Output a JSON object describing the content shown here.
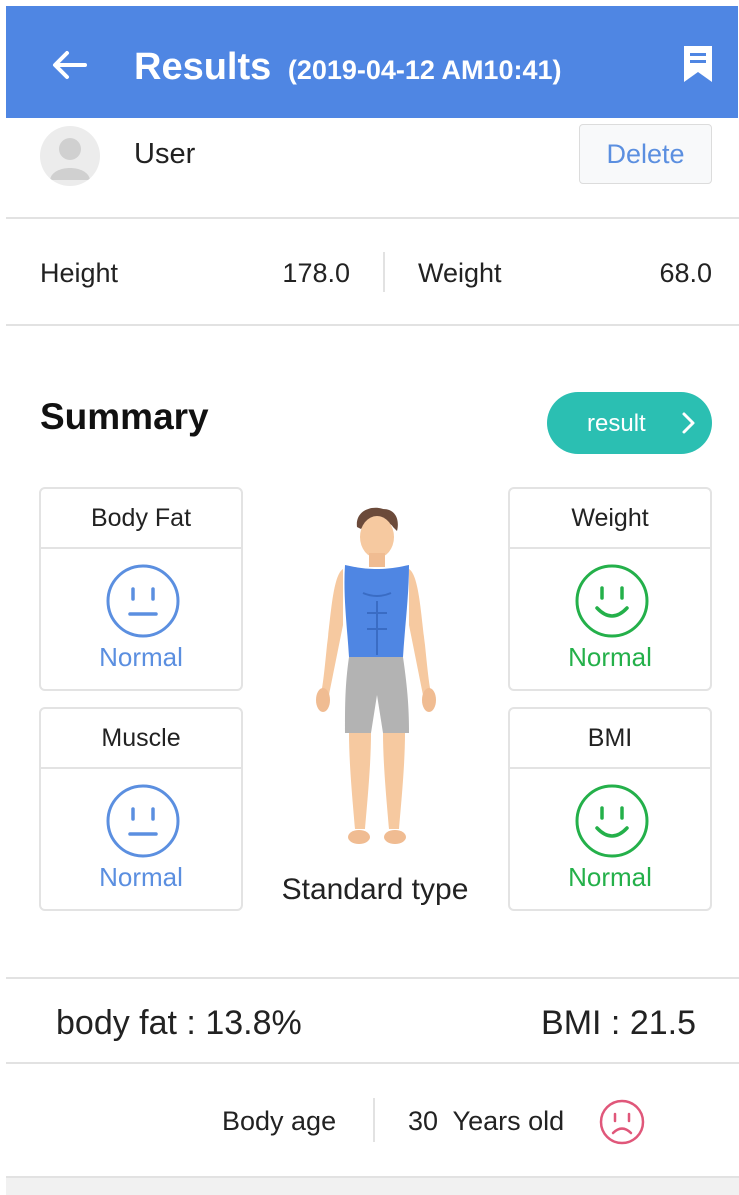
{
  "header": {
    "title": "Results",
    "datetime": "(2019-04-12 AM10:41)",
    "back_icon": "arrow-left-icon",
    "bookmark_icon": "bookmark-icon",
    "bg_color": "#4f86e3"
  },
  "user": {
    "name": "User",
    "delete_label": "Delete"
  },
  "metrics": {
    "height_label": "Height",
    "height_value": "178.0",
    "weight_label": "Weight",
    "weight_value": "68.0"
  },
  "summary": {
    "title": "Summary",
    "result_button": "result",
    "body_type": "Standard type",
    "cards": {
      "body_fat": {
        "title": "Body Fat",
        "status": "Normal",
        "face": "neutral-face-icon",
        "color": "#5b8fe0"
      },
      "weight": {
        "title": "Weight",
        "status": "Normal",
        "face": "smile-face-icon",
        "color": "#24b04a"
      },
      "muscle": {
        "title": "Muscle",
        "status": "Normal",
        "face": "neutral-face-icon",
        "color": "#5b8fe0"
      },
      "bmi": {
        "title": "BMI",
        "status": "Normal",
        "face": "smile-face-icon",
        "color": "#24b04a"
      }
    }
  },
  "stats": {
    "body_fat": "body fat : 13.8%",
    "bmi": "BMI : 21.5"
  },
  "body_age": {
    "label": "Body age",
    "value": "30  Years old",
    "face": "sad-face-icon",
    "face_color": "#e0577a"
  },
  "colors": {
    "accent_teal": "#2bbfb2",
    "normal_blue": "#5b8fe0",
    "normal_green": "#24b04a"
  }
}
